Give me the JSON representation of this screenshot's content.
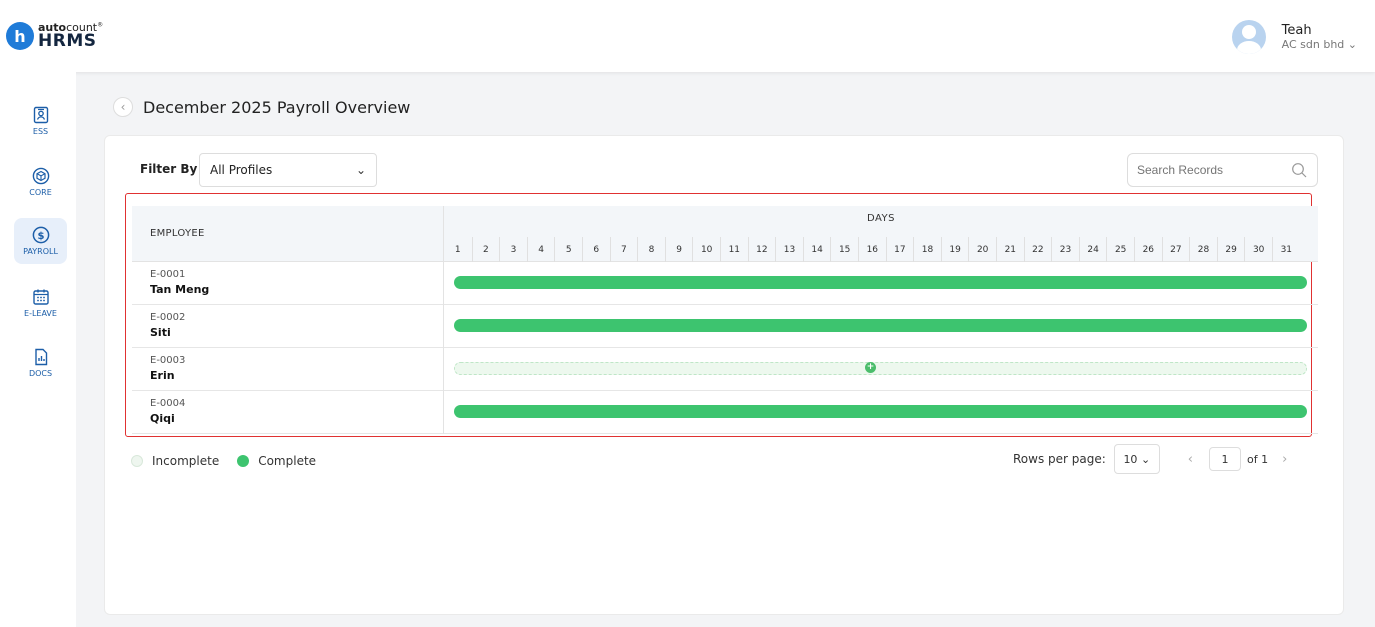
{
  "brand": {
    "top_bold": "auto",
    "top_rest": "count",
    "top_mark": "®",
    "bottom": "HRMS",
    "initial": "h"
  },
  "user": {
    "name": "Teah",
    "company": "AC sdn bhd",
    "chevron": "⌄"
  },
  "sidebar": {
    "items": [
      {
        "label": "ESS",
        "icon": "id-card-icon",
        "active": false
      },
      {
        "label": "CORE",
        "icon": "cube-icon",
        "active": false
      },
      {
        "label": "PAYROLL",
        "icon": "dollar-circle-icon",
        "active": true
      },
      {
        "label": "E-LEAVE",
        "icon": "calendar-icon",
        "active": false
      },
      {
        "label": "DOCS",
        "icon": "document-chart-icon",
        "active": false
      }
    ]
  },
  "page": {
    "back_icon": "‹",
    "title": "December 2025 Payroll Overview"
  },
  "filter": {
    "label": "Filter By",
    "value": "All Profiles",
    "chevron": "⌄"
  },
  "search": {
    "placeholder": "Search Records"
  },
  "table": {
    "employee_header": "EMPLOYEE",
    "days_header": "DAYS",
    "days": [
      "1",
      "2",
      "3",
      "4",
      "5",
      "6",
      "7",
      "8",
      "9",
      "10",
      "11",
      "12",
      "13",
      "14",
      "15",
      "16",
      "17",
      "18",
      "19",
      "20",
      "21",
      "22",
      "23",
      "24",
      "25",
      "26",
      "27",
      "28",
      "29",
      "30",
      "31"
    ],
    "rows": [
      {
        "id": "E-0001",
        "name": "Tan Meng",
        "status": "Complete"
      },
      {
        "id": "E-0002",
        "name": "Siti",
        "status": "Complete"
      },
      {
        "id": "E-0003",
        "name": "Erin",
        "status": "Incomplete"
      },
      {
        "id": "E-0004",
        "name": "Qiqi",
        "status": "Complete"
      }
    ]
  },
  "legend": {
    "incomplete": "Incomplete",
    "complete": "Complete",
    "incomplete_color": "#eef6ef",
    "complete_color": "#3dc46f"
  },
  "pagination": {
    "rows_label": "Rows per page:",
    "rows_value": "10",
    "chevron": "⌄",
    "prev": "‹",
    "current": "1",
    "of": "of 1",
    "next": "›"
  },
  "colors": {
    "accent": "#1f7bd8",
    "complete": "#3dc46f",
    "highlight_border": "#e03131"
  }
}
